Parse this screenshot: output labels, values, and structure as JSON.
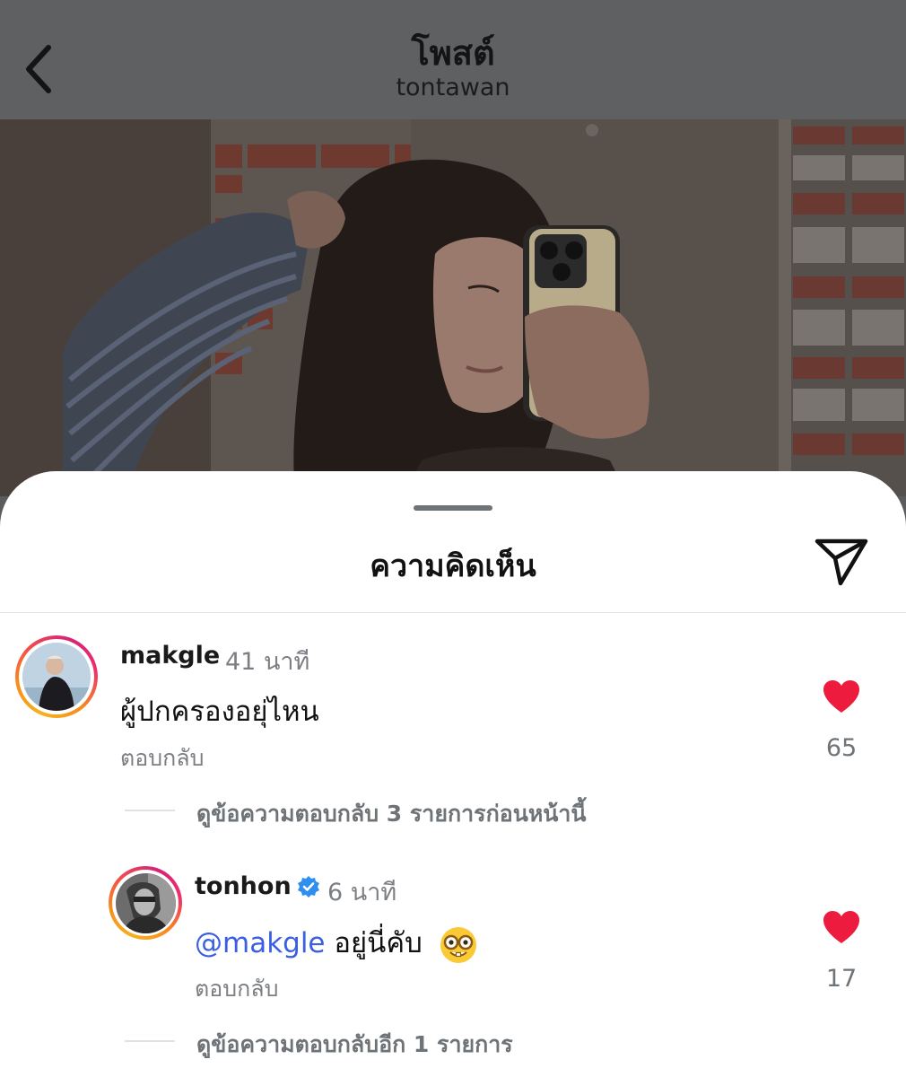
{
  "header": {
    "title": "โพสต์",
    "username": "tontawan",
    "back_icon": "chevron-left-icon"
  },
  "sheet": {
    "title": "ความคิดเห็น",
    "share_icon": "paper-plane-icon"
  },
  "comments": [
    {
      "username": "makgle",
      "time": "41 นาที",
      "text": "ผู้ปกครองอยุ่ไหน",
      "reply_label": "ตอบกลับ",
      "likes": "65",
      "view_replies": "ดูข้อความตอบกลับ 3 รายการก่อนหน้านี้"
    },
    {
      "username": "tonhon",
      "verified": true,
      "time": "6 นาที",
      "mention": "@makgle",
      "text": "อยู่นี่คับ",
      "emoji": "nerd-face-emoji",
      "reply_label": "ตอบกลับ",
      "likes": "17",
      "view_replies": "ดูข้อความตอบกลับอีก 1 รายการ"
    }
  ],
  "colors": {
    "like_heart": "#ed1c3e",
    "mention": "#3b5fe0",
    "verified_badge": "#2e8ff0",
    "overlay_header": "#5f6062"
  }
}
